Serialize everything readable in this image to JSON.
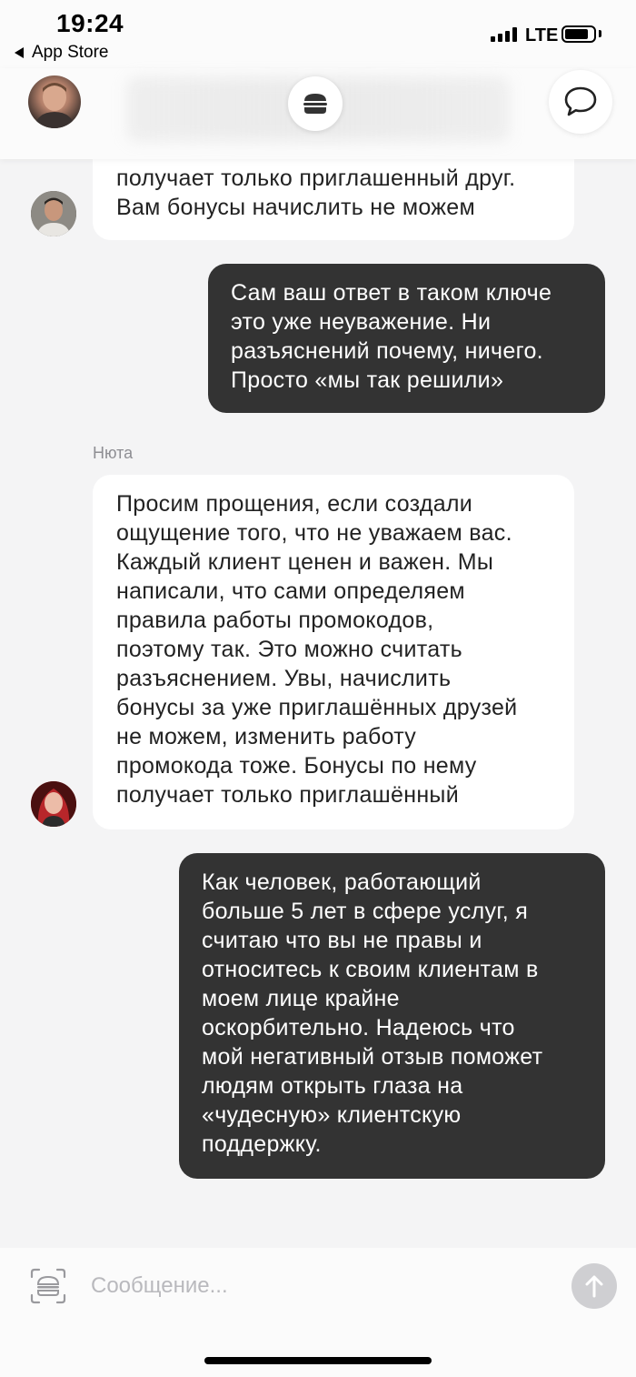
{
  "status_bar": {
    "time": "19:24",
    "back_app": "App Store",
    "network": "LTE"
  },
  "header": {
    "center_icon": "burger-icon",
    "right_icon": "chat-bubble-icon"
  },
  "messages": [
    {
      "direction": "incoming",
      "avatar": "agent-male",
      "lines": [
        "получает только приглашенный друг.",
        "Вам бонусы начислить не можем"
      ]
    },
    {
      "direction": "outgoing",
      "lines": [
        "Сам ваш ответ в таком ключе",
        "это уже неуважение. Ни",
        "разъяснений почему, ничего.",
        "Просто «мы так решили»"
      ]
    },
    {
      "direction": "incoming",
      "sender": "Нюта",
      "avatar": "agent-female",
      "lines": [
        "Просим прощения, если создали",
        "ощущение того, что не уважаем вас.",
        "Каждый клиент ценен и важен. Мы",
        "написали, что сами определяем",
        "правила работы промокодов,",
        "поэтому так. Это можно считать",
        "разъяснением. Увы, начислить",
        "бонусы за уже приглашённых друзей",
        "не можем, изменить работу",
        "промокода тоже. Бонусы по нему",
        "получает только приглашённый"
      ]
    },
    {
      "direction": "outgoing",
      "lines": [
        "Как человек, работающий",
        "больше 5 лет в сфере услуг, я",
        "считаю что вы не правы и",
        "относитесь к своим клиентам в",
        "моем лице крайне",
        "оскорбительно. Надеюсь что",
        "мой негативный отзыв поможет",
        "людям открыть глаза на",
        "«чудесную» клиентскую",
        "поддержку."
      ]
    }
  ],
  "composer": {
    "placeholder": "Сообщение...",
    "value": "",
    "left_icon": "burger-icon",
    "send_icon": "arrow-up-icon"
  },
  "colors": {
    "background": "#f4f4f5",
    "incoming_bubble": "#ffffff",
    "outgoing_bubble": "#333333",
    "send_button": "#cfcfd2"
  }
}
